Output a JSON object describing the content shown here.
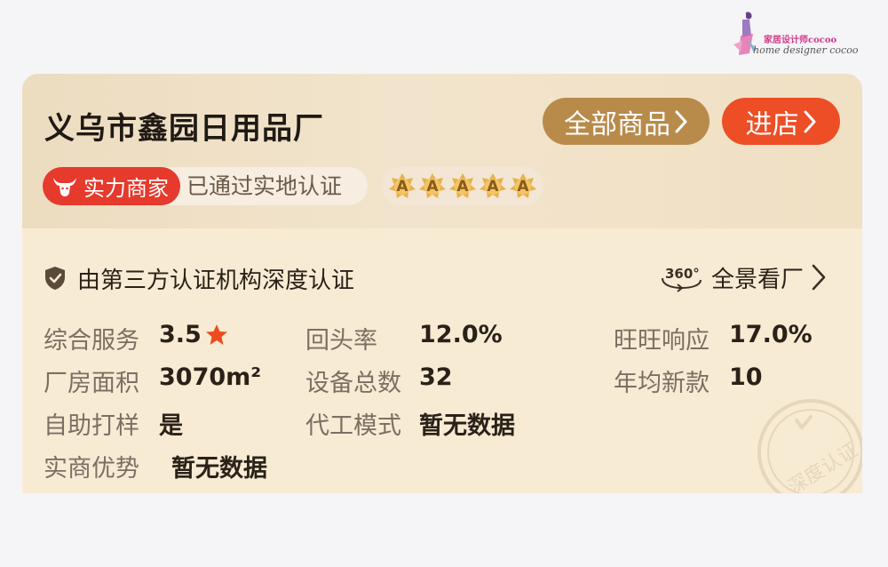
{
  "watermark": {
    "chinese": "家居设计师cocoo",
    "english": "home designer cocoo"
  },
  "shop": {
    "name": "义乌市鑫园日用品厂",
    "all_products_label": "全部商品",
    "enter_store_label": "进店"
  },
  "badges": {
    "power_merchant": "实力商家",
    "verification": "已通过实地认证",
    "rating_letters": [
      "A",
      "A",
      "A",
      "A",
      "A"
    ]
  },
  "certification": {
    "text": "由第三方认证机构深度认证",
    "panorama_badge": "360°",
    "panorama_label": "全景看厂"
  },
  "stats": {
    "service_label": "综合服务",
    "service_value": "3.5",
    "return_label": "回头率",
    "return_value": "12.0%",
    "wangwang_label": "旺旺响应",
    "wangwang_value": "17.0%",
    "area_label": "厂房面积",
    "area_value": "3070m²",
    "equipment_label": "设备总数",
    "equipment_value": "32",
    "new_label": "年均新款",
    "new_value": "10",
    "sample_label": "自助打样",
    "sample_value": "是",
    "oem_label": "代工模式",
    "oem_value": "暂无数据",
    "advantage_label": "实商优势",
    "advantage_value": "暂无数据"
  },
  "stamp_text": "深度认证",
  "colors": {
    "accent_gold": "#b88b4a",
    "accent_red": "#ee4e25",
    "badge_red": "#e53a2c",
    "star_orange": "#ec4c1f"
  },
  "icons": [
    "bull-icon",
    "shield-check-icon",
    "360-view-icon",
    "chevron-right-icon",
    "star-icon",
    "rating-badge-icon"
  ]
}
